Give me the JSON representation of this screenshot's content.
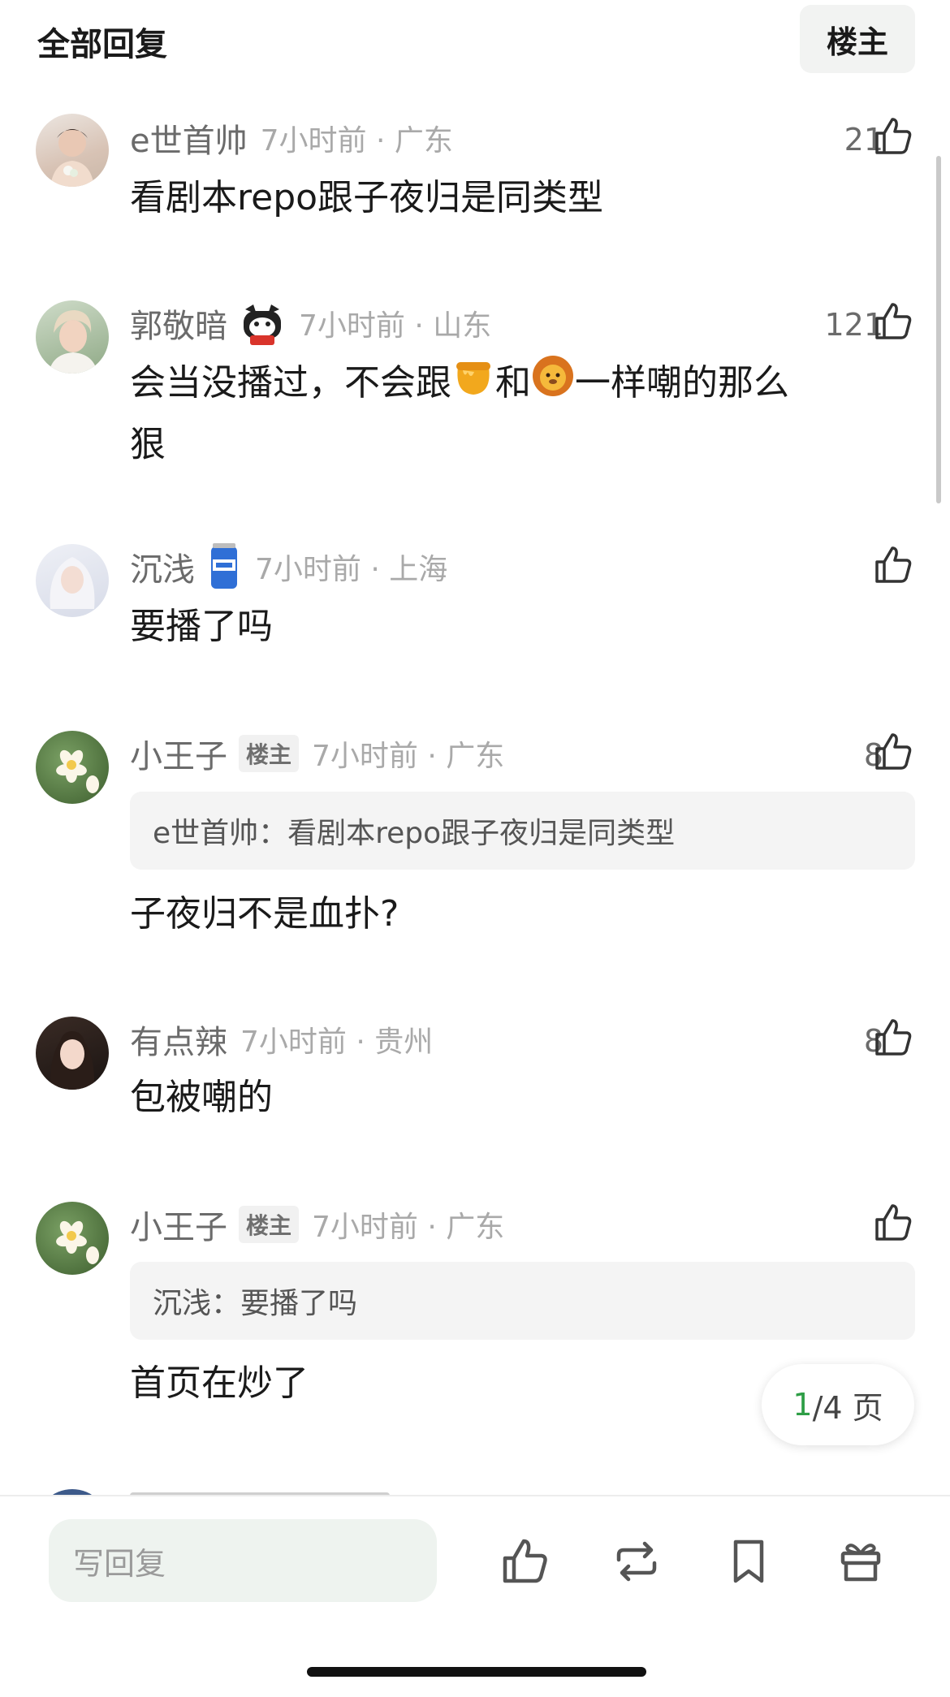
{
  "header": {
    "title": "全部回复",
    "owner_button": "楼主"
  },
  "comments": [
    {
      "username": "e世首帅",
      "meta": "7小时前 · 广东",
      "likes": "21",
      "text": "看剧本repo跟子夜归是同类型"
    },
    {
      "username": "郭敬暗",
      "meta": "7小时前 · 山东",
      "likes": "121",
      "text_a": "会当没播过，不会跟",
      "text_b": "和",
      "text_c": "一样嘲的那么",
      "text_d": "狠"
    },
    {
      "username": "沉浅",
      "meta": "7小时前 · 上海",
      "likes": "",
      "text": "要播了吗"
    },
    {
      "username": "小王子",
      "badge": "楼主",
      "meta": "7小时前 · 广东",
      "likes": "8",
      "quote": "e世首帅：看剧本repo跟子夜归是同类型",
      "text": "子夜归不是血扑?"
    },
    {
      "username": "有点辣",
      "meta": "7小时前 · 贵州",
      "likes": "8",
      "text": "包被嘲的"
    },
    {
      "username": "小王子",
      "badge": "楼主",
      "meta": "7小时前 · 广东",
      "likes": "",
      "quote": "沉浅：要播了吗",
      "text": "首页在炒了"
    }
  ],
  "pagination": {
    "current": "1",
    "total": "/4 页"
  },
  "bottom_bar": {
    "reply_placeholder": "写回复"
  },
  "colors": {
    "accent_green": "#2e9e46",
    "quote_bg": "#f4f4f4",
    "input_bg": "#eef3ef"
  }
}
